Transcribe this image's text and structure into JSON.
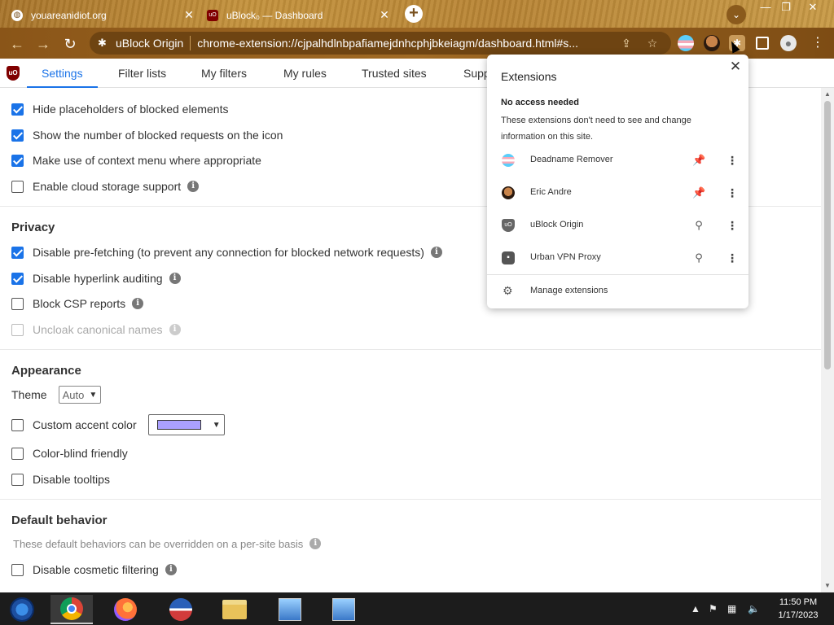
{
  "browser": {
    "tabs": [
      {
        "title": "youareanidiot.org",
        "active": false
      },
      {
        "title": "uBlock₀ — Dashboard",
        "active": true
      }
    ],
    "new_tab": "+",
    "close": "✕",
    "omnibox": {
      "site_name": "uBlock Origin",
      "url": "chrome-extension://cjpalhdlnbpafiamejdnhcphjbkeiagm/dashboard.html#s..."
    }
  },
  "nav_tabs": [
    "Settings",
    "Filter lists",
    "My filters",
    "My rules",
    "Trusted sites",
    "Supp"
  ],
  "settings": {
    "general": [
      {
        "label": "Hide placeholders of blocked elements",
        "checked": true
      },
      {
        "label": "Show the number of blocked requests on the icon",
        "checked": true
      },
      {
        "label": "Make use of context menu where appropriate",
        "checked": true
      },
      {
        "label": "Enable cloud storage support",
        "checked": false,
        "info": true
      }
    ],
    "privacy": {
      "heading": "Privacy",
      "items": [
        {
          "label": "Disable pre-fetching (to prevent any connection for blocked network requests)",
          "checked": true,
          "info": true
        },
        {
          "label": "Disable hyperlink auditing",
          "checked": true,
          "info": true
        },
        {
          "label": "Block CSP reports",
          "checked": false,
          "info": true
        },
        {
          "label": "Uncloak canonical names",
          "checked": false,
          "info": true,
          "disabled": true
        }
      ]
    },
    "appearance": {
      "heading": "Appearance",
      "theme_label": "Theme",
      "theme_value": "Auto",
      "items": [
        {
          "label": "Custom accent color",
          "checked": false
        },
        {
          "label": "Color-blind friendly",
          "checked": false
        },
        {
          "label": "Disable tooltips",
          "checked": false
        }
      ],
      "accent_color": "#aaa0ff"
    },
    "default_behavior": {
      "heading": "Default behavior",
      "note": "These default behaviors can be overridden on a per-site basis",
      "items": [
        {
          "label": "Disable cosmetic filtering",
          "checked": false
        }
      ]
    }
  },
  "extensions_popup": {
    "title": "Extensions",
    "section": "No access needed",
    "desc": "These extensions don't need to see and change information on this site.",
    "items": [
      {
        "name": "Deadname Remover",
        "pinned": true
      },
      {
        "name": "Eric Andre",
        "pinned": true
      },
      {
        "name": "uBlock Origin",
        "pinned": false
      },
      {
        "name": "Urban VPN Proxy",
        "pinned": false
      }
    ],
    "manage": "Manage extensions"
  },
  "taskbar": {
    "clock_time": "11:50 PM",
    "clock_date": "1/17/2023"
  },
  "colors": {
    "accent": "#1a73e8",
    "pin_active": "#1a73e8",
    "pin_inactive": "#555555"
  }
}
